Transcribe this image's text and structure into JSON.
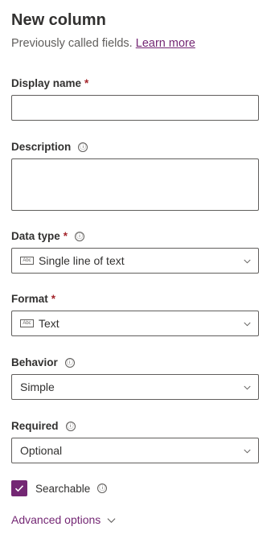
{
  "panel": {
    "title": "New column",
    "subtitle": "Previously called fields.",
    "learn_more": "Learn more"
  },
  "fields": {
    "display_name": {
      "label": "Display name",
      "required_mark": "*",
      "value": ""
    },
    "description": {
      "label": "Description",
      "value": ""
    },
    "data_type": {
      "label": "Data type",
      "required_mark": "*",
      "value": "Single line of text",
      "icon": "abc-text-icon"
    },
    "format": {
      "label": "Format",
      "required_mark": "*",
      "value": "Text",
      "icon": "abc-text-icon"
    },
    "behavior": {
      "label": "Behavior",
      "value": "Simple"
    },
    "required": {
      "label": "Required",
      "value": "Optional"
    }
  },
  "searchable": {
    "label": "Searchable",
    "checked": true
  },
  "advanced": {
    "label": "Advanced options"
  },
  "icons": {
    "info": "ⓘ",
    "abc": "Abc"
  },
  "colors": {
    "accent": "#742774",
    "required": "#a4262c",
    "border": "#605e5c"
  }
}
